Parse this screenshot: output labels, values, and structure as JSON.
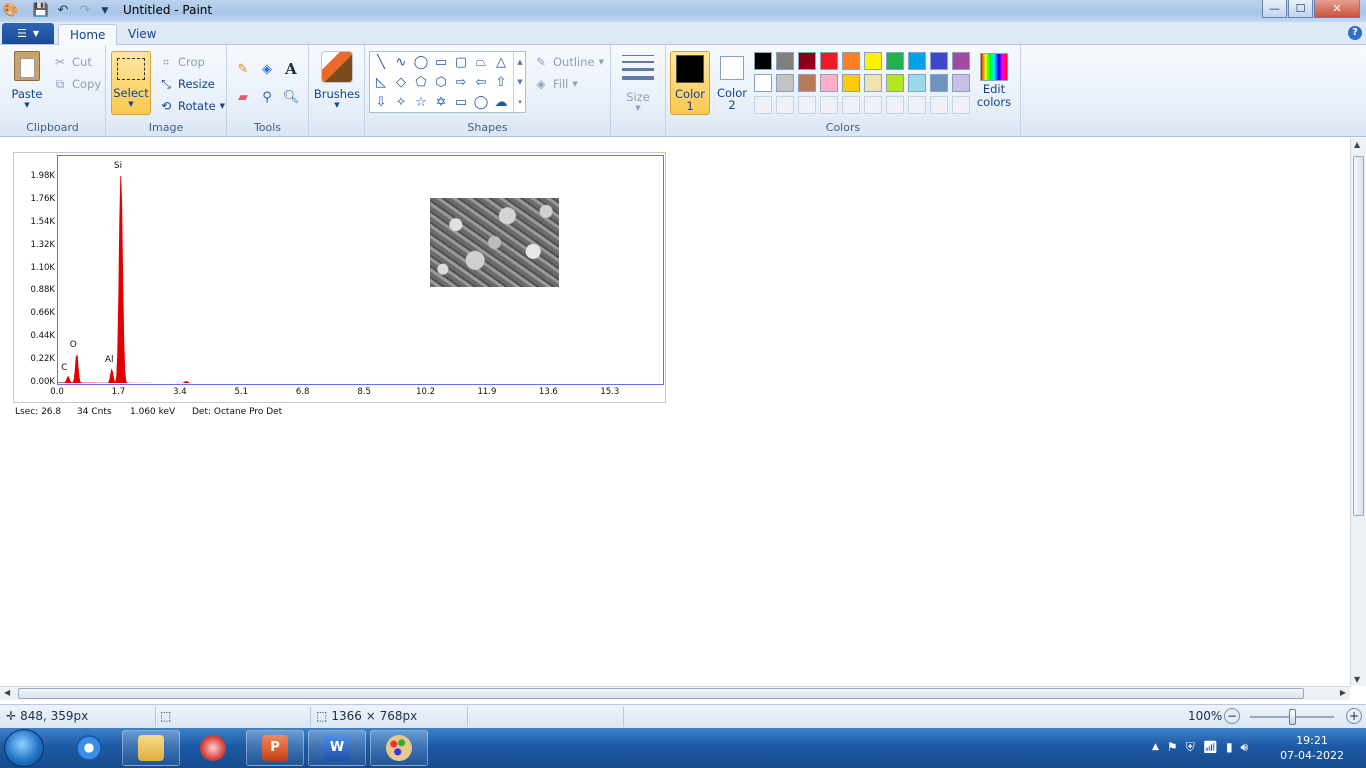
{
  "window": {
    "title": "Untitled - Paint",
    "minimize": "—",
    "maximize": "☐",
    "close": "✕"
  },
  "tabs": [
    "Home",
    "View"
  ],
  "help": "?",
  "clipboard": {
    "group": "Clipboard",
    "paste": "Paste",
    "cut": "Cut",
    "copy": "Copy"
  },
  "image_group": {
    "group": "Image",
    "select": "Select",
    "crop": "Crop",
    "resize": "Resize",
    "rotate": "Rotate"
  },
  "tools": {
    "group": "Tools"
  },
  "brushes": {
    "label": "Brushes"
  },
  "shapes": {
    "group": "Shapes",
    "outline": "Outline",
    "fill": "Fill"
  },
  "size": {
    "label": "Size"
  },
  "colors": {
    "group": "Colors",
    "color1": "Color 1",
    "color2": "Color 2",
    "color1_value": "#000000",
    "color2_value": "#ffffff",
    "edit": "Edit colors",
    "palette_row1": [
      "#000000",
      "#7f7f7f",
      "#880015",
      "#ed1c24",
      "#ff7f27",
      "#fff200",
      "#22b14c",
      "#00a2e8",
      "#3f48cc",
      "#a349a4"
    ],
    "palette_row2": [
      "#ffffff",
      "#c3c3c3",
      "#b97a57",
      "#ffaec9",
      "#ffc90e",
      "#efe4b0",
      "#b5e61d",
      "#99d9ea",
      "#7092be",
      "#c8bfe7"
    ]
  },
  "chart_data": {
    "type": "line",
    "yticks": [
      "1.98K",
      "1.76K",
      "1.54K",
      "1.32K",
      "1.10K",
      "0.88K",
      "0.66K",
      "0.44K",
      "0.22K",
      "0.00K"
    ],
    "xticks": [
      "0.0",
      "1.7",
      "3.4",
      "5.1",
      "6.8",
      "8.5",
      "10.2",
      "11.9",
      "13.6",
      "15.3"
    ],
    "xlim": [
      0,
      16.8
    ],
    "ylim": [
      0,
      2.2
    ],
    "peaks": [
      {
        "label": "C",
        "x": 0.28,
        "y": 0.06
      },
      {
        "label": "O",
        "x": 0.52,
        "y": 0.28
      },
      {
        "label": "Al",
        "x": 1.49,
        "y": 0.13
      },
      {
        "label": "Si",
        "x": 1.74,
        "y": 2.0
      }
    ],
    "details": [
      "Lsec: 26.8",
      "34 Cnts",
      "1.060 keV",
      "Det: Octane Pro Det"
    ],
    "color": "#e00000"
  },
  "status": {
    "cursor": "848, 359px",
    "selection": "",
    "canvas_size": "1366 × 768px",
    "zoom": "100%"
  },
  "taskbar": {
    "time": "19:21",
    "date": "07-04-2022"
  }
}
